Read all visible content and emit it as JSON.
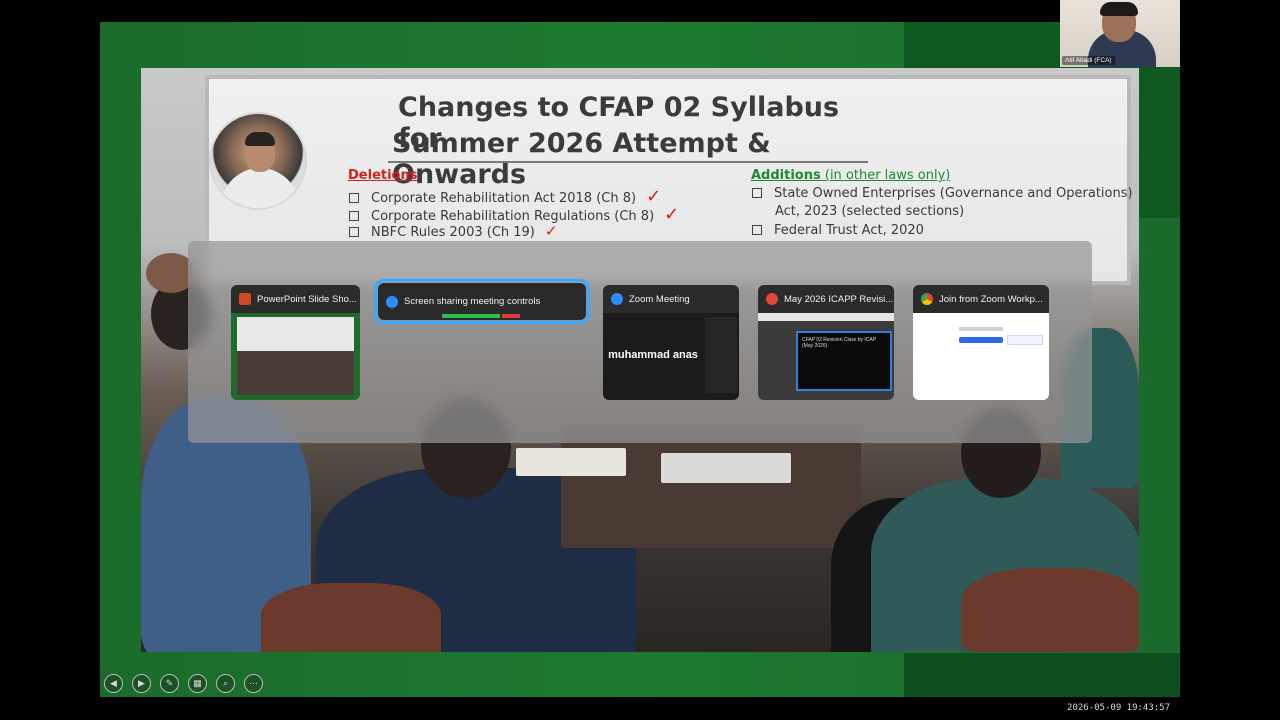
{
  "slide": {
    "title_line1": "Changes to CFAP 02 Syllabus for",
    "title_line2": "Summer 2026 Attempt & Onwards",
    "deletions": {
      "heading": "Deletions",
      "items": [
        "Corporate Rehabilitation Act 2018 (Ch 8)",
        "Corporate Rehabilitation Regulations (Ch 8)",
        "NBFC Rules 2003 (Ch 19)"
      ]
    },
    "additions": {
      "heading": "Additions",
      "note": " (in other laws only)",
      "items": [
        "State Owned Enterprises (Governance and Operations)",
        "Act, 2023 (selected sections)",
        "Federal Trust Act, 2020"
      ]
    }
  },
  "switcher": {
    "windows": [
      {
        "title": "PowerPoint Slide Sho...",
        "icon": "powerpoint-icon",
        "color": "#d24726"
      },
      {
        "title": "Screen sharing meeting controls",
        "icon": "zoom-icon",
        "color": "#2d8cff"
      },
      {
        "title": "Zoom Meeting",
        "icon": "zoom-icon",
        "color": "#2d8cff"
      },
      {
        "title": "May 2026 ICAPP Revisi...",
        "icon": "pdf-icon",
        "color": "#e0443a"
      },
      {
        "title": "Join from Zoom Workp...",
        "icon": "chrome-icon",
        "color": "#4285f4"
      }
    ],
    "zoom_meeting_participant": "muhammad anas",
    "pdf_thumb_title": "CFAP 02 Revision Class by ICAP (May 2026)"
  },
  "self_video": {
    "name": "Atif Abadi (FCA)"
  },
  "toolbar": {
    "buttons": [
      "prev-icon",
      "pointer-icon",
      "pen-icon",
      "slides-icon",
      "zoom-icon",
      "more-icon"
    ]
  },
  "timestamp": "2026-05-09 19:43:57"
}
